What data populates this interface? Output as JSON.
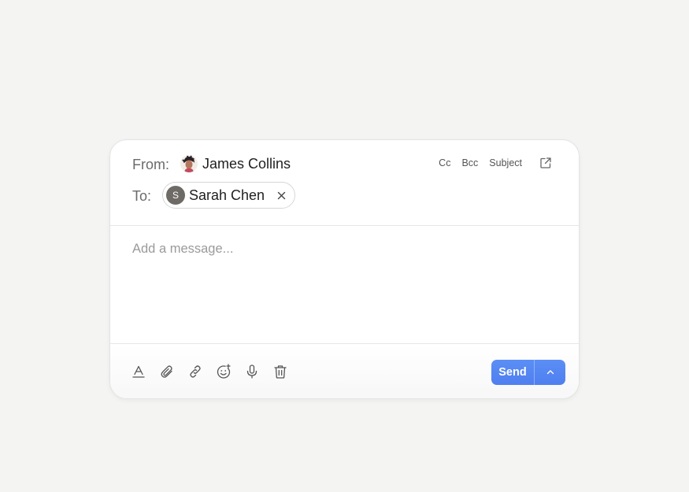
{
  "composer": {
    "from_label": "From:",
    "sender_name": "James Collins",
    "to_label": "To:",
    "recipient": {
      "initial": "S",
      "name": "Sarah Chen"
    },
    "top_links": {
      "cc": "Cc",
      "bcc": "Bcc",
      "subject": "Subject"
    },
    "message_placeholder": "Add a message...",
    "send_label": "Send"
  },
  "colors": {
    "accent": "#4f80f0",
    "background": "#f4f4f3",
    "recipient_avatar": "#6e6a66"
  },
  "icons": {
    "toolbar": [
      "text-format-icon",
      "attachment-icon",
      "link-icon",
      "emoji-icon",
      "microphone-icon",
      "trash-icon"
    ],
    "popout": "external-link-icon",
    "remove": "close-icon",
    "send_options": "chevron-up-icon"
  }
}
